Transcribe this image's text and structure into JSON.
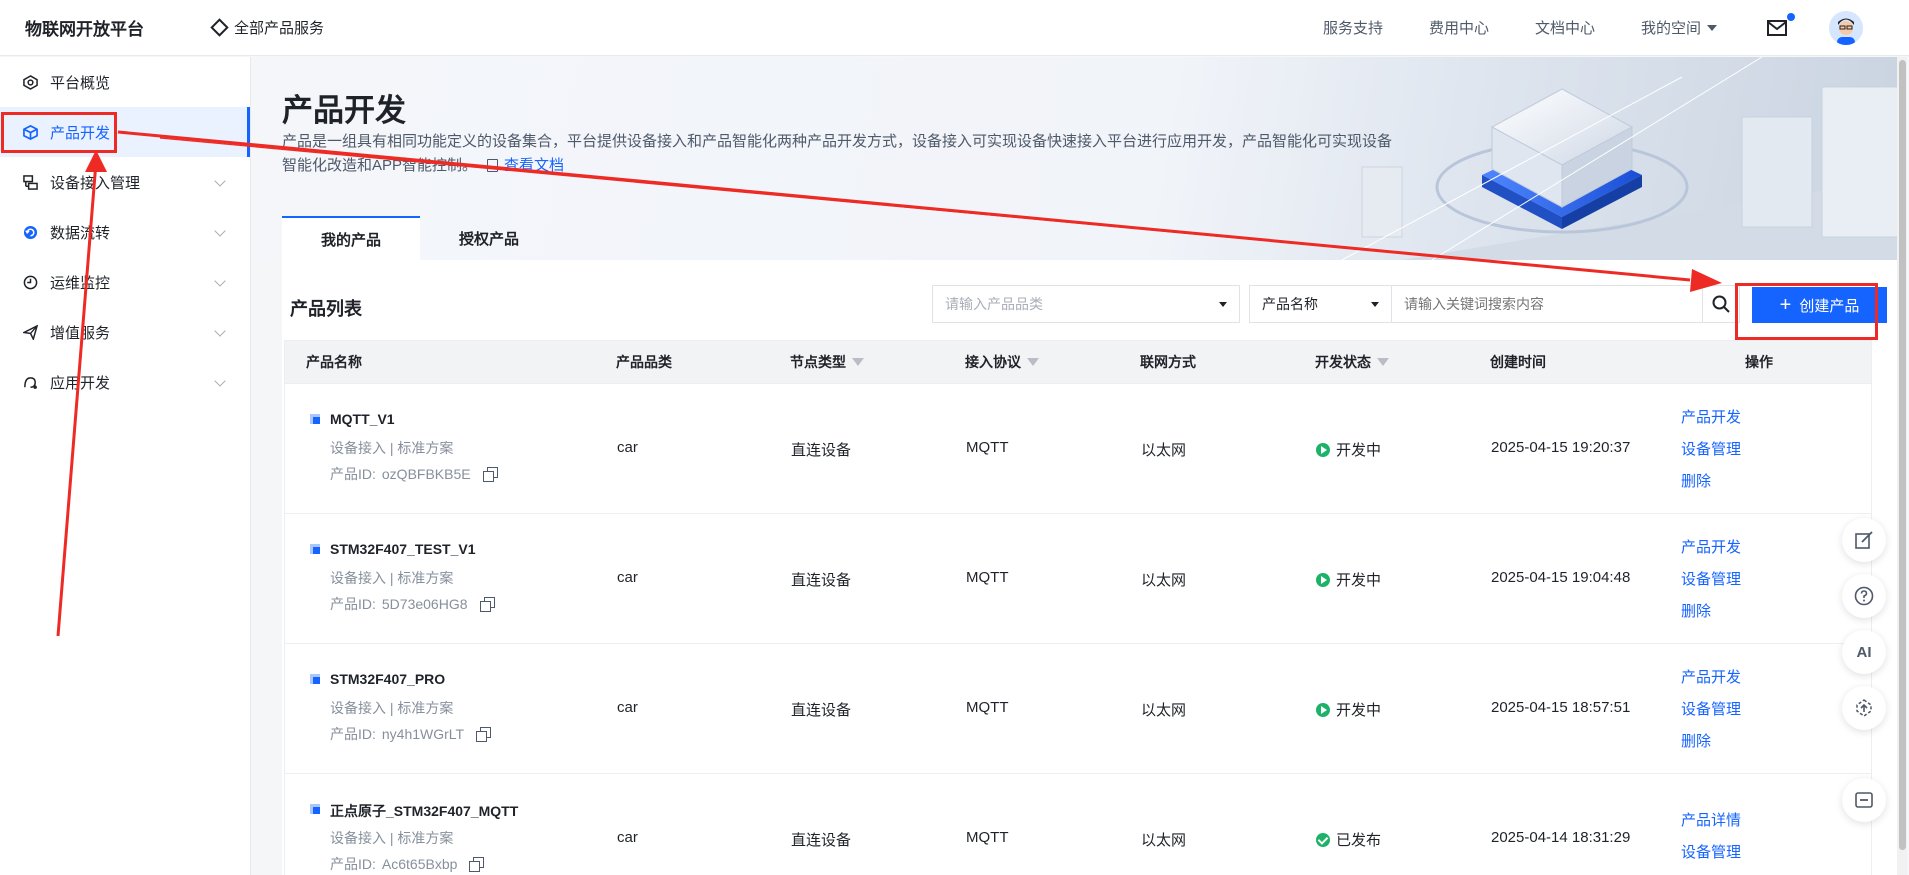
{
  "header": {
    "brand": "物联网开放平台",
    "all_services": "全部产品服务",
    "links": [
      "服务支持",
      "费用中心",
      "文档中心"
    ],
    "my_space": "我的空间"
  },
  "sidebar": {
    "items": [
      {
        "label": "平台概览",
        "icon": "gauge-icon",
        "expandable": false,
        "active": false
      },
      {
        "label": "产品开发",
        "icon": "cube-icon",
        "expandable": false,
        "active": true
      },
      {
        "label": "设备接入管理",
        "icon": "device-icon",
        "expandable": true,
        "active": false
      },
      {
        "label": "数据流转",
        "icon": "refresh-icon",
        "expandable": true,
        "active": false
      },
      {
        "label": "运维监控",
        "icon": "clock-icon",
        "expandable": true,
        "active": false
      },
      {
        "label": "增值服务",
        "icon": "send-icon",
        "expandable": true,
        "active": false
      },
      {
        "label": "应用开发",
        "icon": "app-icon",
        "expandable": true,
        "active": false
      }
    ]
  },
  "page": {
    "title": "产品开发",
    "description": "产品是一组具有相同功能定义的设备集合，平台提供设备接入和产品智能化两种产品开发方式，设备接入可实现设备快速接入平台进行应用开发，产品智能化可实现设备智能化改造和APP智能控制。",
    "doc_link": "查看文档",
    "tabs": [
      "我的产品",
      "授权产品"
    ]
  },
  "toolbar": {
    "list_title": "产品列表",
    "category_placeholder": "请输入产品品类",
    "search_field": "产品名称",
    "keyword_placeholder": "请输入关键词搜索内容",
    "create_label": "创建产品"
  },
  "table": {
    "columns": [
      "产品名称",
      "产品品类",
      "节点类型",
      "接入协议",
      "联网方式",
      "开发状态",
      "创建时间",
      "操作"
    ],
    "rows": [
      {
        "name": "MQTT_V1",
        "sub": "设备接入  |  标准方案",
        "id_label": "产品ID:",
        "id": "ozQBFBKB5E",
        "category": "car",
        "node": "直连设备",
        "protocol": "MQTT",
        "network": "以太网",
        "status": "开发中",
        "created": "2025-04-15 19:20:37",
        "ops": [
          "产品开发",
          "设备管理",
          "删除"
        ]
      },
      {
        "name": "STM32F407_TEST_V1",
        "sub": "设备接入  |  标准方案",
        "id_label": "产品ID:",
        "id": "5D73e06HG8",
        "category": "car",
        "node": "直连设备",
        "protocol": "MQTT",
        "network": "以太网",
        "status": "开发中",
        "created": "2025-04-15 19:04:48",
        "ops": [
          "产品开发",
          "设备管理",
          "删除"
        ]
      },
      {
        "name": "STM32F407_PRO",
        "sub": "设备接入  |  标准方案",
        "id_label": "产品ID:",
        "id": "ny4h1WGrLT",
        "category": "car",
        "node": "直连设备",
        "protocol": "MQTT",
        "network": "以太网",
        "status": "开发中",
        "created": "2025-04-15 18:57:51",
        "ops": [
          "产品开发",
          "设备管理",
          "删除"
        ]
      },
      {
        "name": "正点原子_STM32F407_MQTT",
        "sub": "设备接入  |  标准方案",
        "id_label": "产品ID:",
        "id": "Ac6t65Bxbp",
        "category": "car",
        "node": "直连设备",
        "protocol": "MQTT",
        "network": "以太网",
        "status": "已发布",
        "created": "2025-04-14 18:31:29",
        "ops": [
          "产品详情",
          "设备管理"
        ]
      }
    ]
  },
  "float_tools": [
    {
      "icon": "edit-icon",
      "label": ""
    },
    {
      "icon": "help-icon",
      "label": ""
    },
    {
      "icon": "ai-icon",
      "label": "AI"
    },
    {
      "icon": "upload-icon",
      "label": ""
    },
    {
      "icon": "collapse-icon",
      "label": ""
    }
  ],
  "colors": {
    "accent": "#1664ff",
    "annotation": "#ee2a24",
    "status_green": "#1cb267"
  }
}
